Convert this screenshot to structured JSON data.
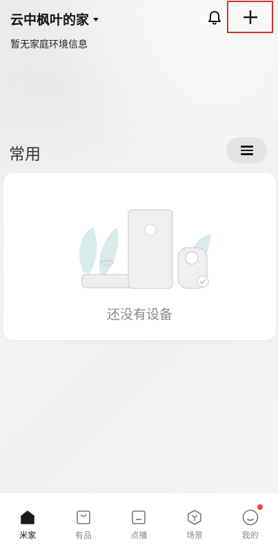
{
  "header": {
    "home_name": "云中枫叶的家",
    "env_info": "暂无家庭环境信息"
  },
  "section": {
    "title": "常用"
  },
  "empty_state": {
    "text": "还没有设备"
  },
  "tabs": [
    {
      "label": "米家",
      "icon": "home-icon",
      "active": true
    },
    {
      "label": "有品",
      "icon": "bag-icon",
      "active": false
    },
    {
      "label": "点播",
      "icon": "tv-icon",
      "active": false
    },
    {
      "label": "场景",
      "icon": "scene-icon",
      "active": false
    },
    {
      "label": "我的",
      "icon": "smile-icon",
      "active": false
    }
  ],
  "colors": {
    "highlight_border": "#d0302a",
    "notification_dot": "#e8443a",
    "illustration_leaf": "#d8ece9"
  }
}
